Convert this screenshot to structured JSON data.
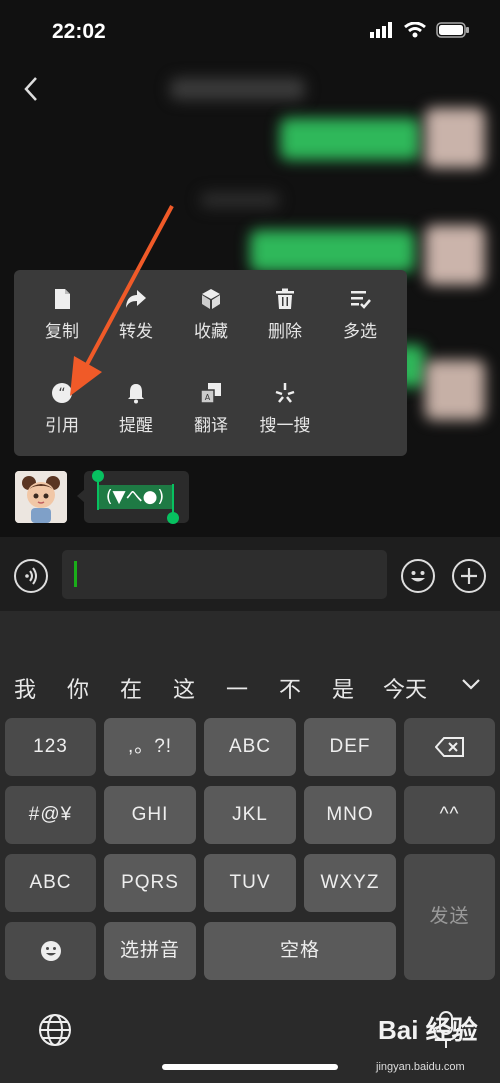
{
  "status_bar": {
    "time": "22:02"
  },
  "context_menu": {
    "row1": [
      {
        "label": "复制",
        "icon": "document-icon"
      },
      {
        "label": "转发",
        "icon": "forward-icon"
      },
      {
        "label": "收藏",
        "icon": "cube-icon"
      },
      {
        "label": "删除",
        "icon": "trash-icon"
      },
      {
        "label": "多选",
        "icon": "multiselect-icon"
      }
    ],
    "row2": [
      {
        "label": "引用",
        "icon": "quote-icon"
      },
      {
        "label": "提醒",
        "icon": "bell-icon"
      },
      {
        "label": "翻译",
        "icon": "translate-icon"
      },
      {
        "label": "搜一搜",
        "icon": "search-sparkle-icon"
      }
    ]
  },
  "message": {
    "selected_text": "(▼へ●)"
  },
  "candidates": [
    "我",
    "你",
    "在",
    "这",
    "一",
    "不",
    "是",
    "今天"
  ],
  "keyboard": {
    "k_123": "123",
    "k_punct": ",。?!",
    "k_abc": "ABC",
    "k_def": "DEF",
    "k_sym": "#@¥",
    "k_ghi": "GHI",
    "k_jkl": "JKL",
    "k_mno": "MNO",
    "k_face": "^^",
    "k_abc_mode": "ABC",
    "k_pqrs": "PQRS",
    "k_tuv": "TUV",
    "k_wxyz": "WXYZ",
    "send": "发送",
    "pinyin": "选拼音",
    "space": "空格"
  },
  "watermark": {
    "brand": "Bai 经验",
    "url": "jingyan.baidu.com"
  },
  "colors": {
    "accent": "#07c160",
    "arrow": "#f05a28"
  }
}
